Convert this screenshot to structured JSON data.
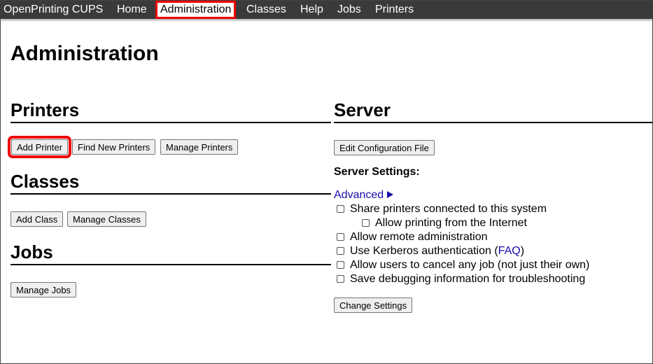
{
  "nav": {
    "brand": "OpenPrinting CUPS",
    "items": [
      "Home",
      "Administration",
      "Classes",
      "Help",
      "Jobs",
      "Printers"
    ]
  },
  "page": {
    "title": "Administration"
  },
  "printers": {
    "heading": "Printers",
    "add_label": "Add Printer",
    "find_label": "Find New Printers",
    "manage_label": "Manage Printers"
  },
  "classes": {
    "heading": "Classes",
    "add_label": "Add Class",
    "manage_label": "Manage Classes"
  },
  "jobs": {
    "heading": "Jobs",
    "manage_label": "Manage Jobs"
  },
  "server": {
    "heading": "Server",
    "edit_config_label": "Edit Configuration File",
    "settings_label": "Server Settings:",
    "advanced_label": "Advanced",
    "options": [
      {
        "label": "Share printers connected to this system",
        "checked": false
      },
      {
        "label": "Allow printing from the Internet",
        "checked": false
      },
      {
        "label": "Allow remote administration",
        "checked": false
      },
      {
        "label_before": "Use Kerberos authentication (",
        "link": "FAQ",
        "label_after": ")",
        "checked": false
      },
      {
        "label": "Allow users to cancel any job (not just their own)",
        "checked": false
      },
      {
        "label": "Save debugging information for troubleshooting",
        "checked": false
      }
    ],
    "change_settings_label": "Change Settings"
  },
  "colors": {
    "nav_bg": "#3a3a3a",
    "highlight": "#ee0000",
    "link": "#1a0dab"
  }
}
